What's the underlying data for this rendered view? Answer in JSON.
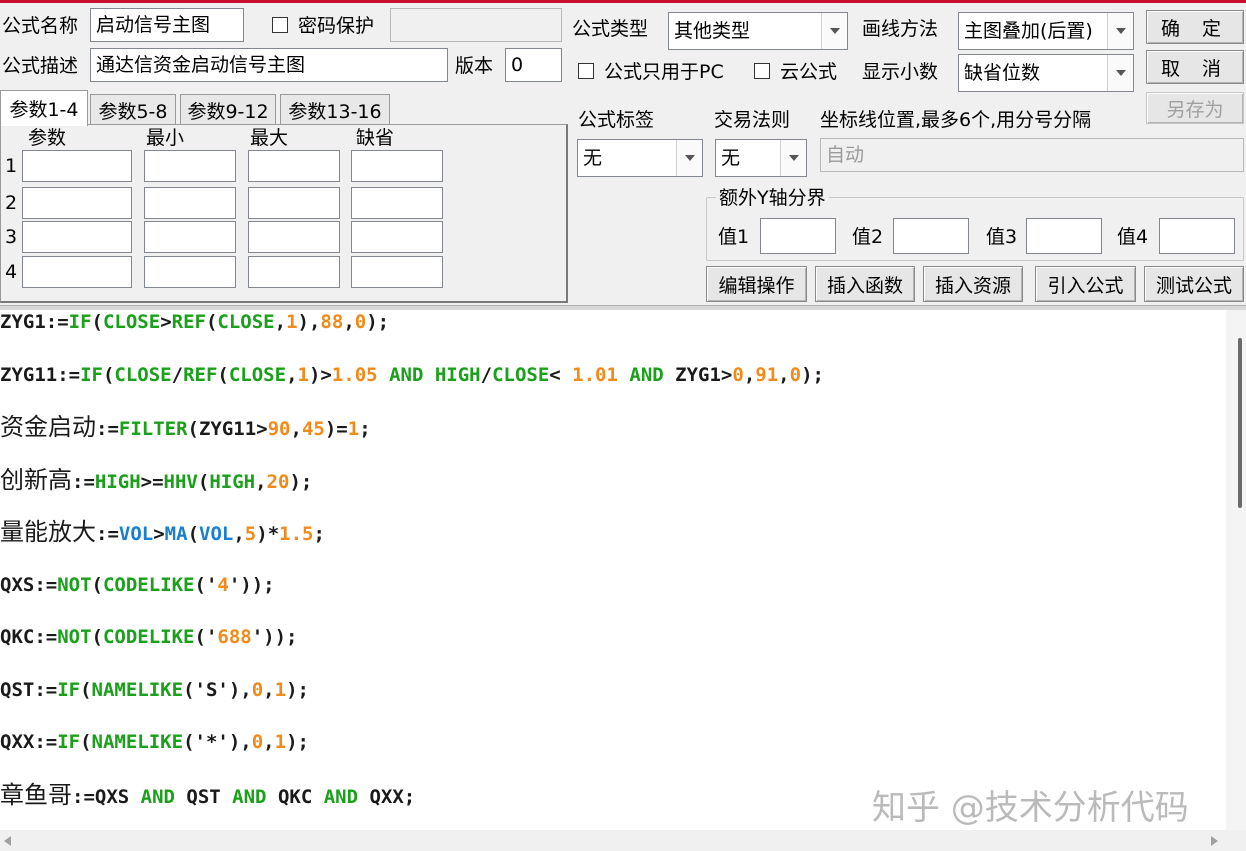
{
  "colors": {
    "title_bar_accent": "#c8102e",
    "code_default": "#1a1a1a",
    "code_function": "#1aa01a",
    "code_number": "#f08a1a",
    "code_volume": "#1a7fd0"
  },
  "form": {
    "name_label": "公式名称",
    "name_value": "启动信号主图",
    "password_label": "密码保护",
    "password_value": "",
    "desc_label": "公式描述",
    "desc_value": "通达信资金启动信号主图",
    "version_label": "版本",
    "version_value": "0",
    "type_label": "公式类型",
    "type_value": "其他类型",
    "draw_label": "画线方法",
    "draw_value": "主图叠加(后置)",
    "pc_only_label": "公式只用于PC",
    "cloud_label": "云公式",
    "decimal_label": "显示小数",
    "decimal_value": "缺省位数",
    "tag_label": "公式标签",
    "tag_value": "无",
    "trade_label": "交易法则",
    "trade_value": "无",
    "axis_label": "坐标线位置,最多6个,用分号分隔",
    "axis_placeholder": "自动",
    "extra_y_label": "额外Y轴分界",
    "extra_y_values": [
      {
        "label": "值1",
        "value": ""
      },
      {
        "label": "值2",
        "value": ""
      },
      {
        "label": "值3",
        "value": ""
      },
      {
        "label": "值4",
        "value": ""
      }
    ]
  },
  "buttons": {
    "ok": "确 定",
    "cancel": "取 消",
    "save_as": "另存为",
    "edit_ops": "编辑操作",
    "insert_func": "插入函数",
    "insert_resource": "插入资源",
    "import_formula": "引入公式",
    "test_formula": "测试公式"
  },
  "tabs": [
    "参数1-4",
    "参数5-8",
    "参数9-12",
    "参数13-16"
  ],
  "params": {
    "headers": [
      "参数",
      "最小",
      "最大",
      "缺省"
    ],
    "rows": [
      {
        "index": "1",
        "name": "",
        "min": "",
        "max": "",
        "default": ""
      },
      {
        "index": "2",
        "name": "",
        "min": "",
        "max": "",
        "default": ""
      },
      {
        "index": "3",
        "name": "",
        "min": "",
        "max": "",
        "default": ""
      },
      {
        "index": "4",
        "name": "",
        "min": "",
        "max": "",
        "default": ""
      }
    ]
  },
  "code": [
    [
      [
        "d",
        "ZYG1:="
      ],
      [
        "f",
        "IF"
      ],
      [
        "d",
        "("
      ],
      [
        "f",
        "CLOSE"
      ],
      [
        "d",
        ">"
      ],
      [
        "f",
        "REF"
      ],
      [
        "d",
        "("
      ],
      [
        "f",
        "CLOSE"
      ],
      [
        "d",
        ","
      ],
      [
        "n",
        "1"
      ],
      [
        "d",
        "),"
      ],
      [
        "n",
        "88"
      ],
      [
        "d",
        ","
      ],
      [
        "n",
        "0"
      ],
      [
        "d",
        ");"
      ]
    ],
    [
      [
        "d",
        "ZYG11:="
      ],
      [
        "f",
        "IF"
      ],
      [
        "d",
        "("
      ],
      [
        "f",
        "CLOSE"
      ],
      [
        "d",
        "/"
      ],
      [
        "f",
        "REF"
      ],
      [
        "d",
        "("
      ],
      [
        "f",
        "CLOSE"
      ],
      [
        "d",
        ","
      ],
      [
        "n",
        "1"
      ],
      [
        "d",
        ")>"
      ],
      [
        "n",
        "1.05"
      ],
      [
        "d",
        " "
      ],
      [
        "f",
        "AND"
      ],
      [
        "d",
        " "
      ],
      [
        "f",
        "HIGH"
      ],
      [
        "d",
        "/"
      ],
      [
        "f",
        "CLOSE"
      ],
      [
        "d",
        "< "
      ],
      [
        "n",
        "1.01"
      ],
      [
        "d",
        " "
      ],
      [
        "f",
        "AND"
      ],
      [
        "d",
        " ZYG1>"
      ],
      [
        "n",
        "0"
      ],
      [
        "d",
        ","
      ],
      [
        "n",
        "91"
      ],
      [
        "d",
        ","
      ],
      [
        "n",
        "0"
      ],
      [
        "d",
        ");"
      ]
    ],
    [
      [
        "c",
        "资金启动"
      ],
      [
        "d",
        ":="
      ],
      [
        "f",
        "FILTER"
      ],
      [
        "d",
        "(ZYG11>"
      ],
      [
        "n",
        "90"
      ],
      [
        "d",
        ","
      ],
      [
        "n",
        "45"
      ],
      [
        "d",
        ")="
      ],
      [
        "n",
        "1"
      ],
      [
        "d",
        ";"
      ]
    ],
    [
      [
        "c",
        "创新高"
      ],
      [
        "d",
        ":="
      ],
      [
        "f",
        "HIGH"
      ],
      [
        "d",
        ">="
      ],
      [
        "f",
        "HHV"
      ],
      [
        "d",
        "("
      ],
      [
        "f",
        "HIGH"
      ],
      [
        "d",
        ","
      ],
      [
        "n",
        "20"
      ],
      [
        "d",
        ");"
      ]
    ],
    [
      [
        "c",
        "量能放大"
      ],
      [
        "d",
        ":="
      ],
      [
        "v",
        "VOL"
      ],
      [
        "d",
        ">"
      ],
      [
        "v",
        "MA"
      ],
      [
        "d",
        "("
      ],
      [
        "v",
        "VOL"
      ],
      [
        "d",
        ","
      ],
      [
        "n",
        "5"
      ],
      [
        "d",
        ")*"
      ],
      [
        "n",
        "1.5"
      ],
      [
        "d",
        ";"
      ]
    ],
    [
      [
        "d",
        "QXS:="
      ],
      [
        "f",
        "NOT"
      ],
      [
        "d",
        "("
      ],
      [
        "f",
        "CODELIKE"
      ],
      [
        "d",
        "('"
      ],
      [
        "n",
        "4"
      ],
      [
        "d",
        "'));"
      ]
    ],
    [
      [
        "d",
        "QKC:="
      ],
      [
        "f",
        "NOT"
      ],
      [
        "d",
        "("
      ],
      [
        "f",
        "CODELIKE"
      ],
      [
        "d",
        "('"
      ],
      [
        "n",
        "688"
      ],
      [
        "d",
        "'));"
      ]
    ],
    [
      [
        "d",
        "QST:="
      ],
      [
        "f",
        "IF"
      ],
      [
        "d",
        "("
      ],
      [
        "f",
        "NAMELIKE"
      ],
      [
        "d",
        "('S'),"
      ],
      [
        "n",
        "0"
      ],
      [
        "d",
        ","
      ],
      [
        "n",
        "1"
      ],
      [
        "d",
        ");"
      ]
    ],
    [
      [
        "d",
        "QXX:="
      ],
      [
        "f",
        "IF"
      ],
      [
        "d",
        "("
      ],
      [
        "f",
        "NAMELIKE"
      ],
      [
        "d",
        "('*'),"
      ],
      [
        "n",
        "0"
      ],
      [
        "d",
        ","
      ],
      [
        "n",
        "1"
      ],
      [
        "d",
        ");"
      ]
    ],
    [
      [
        "c",
        "章鱼哥"
      ],
      [
        "d",
        ":=QXS "
      ],
      [
        "f",
        "AND"
      ],
      [
        "d",
        " QST "
      ],
      [
        "f",
        "AND"
      ],
      [
        "d",
        " QKC "
      ],
      [
        "f",
        "AND"
      ],
      [
        "d",
        " QXX;"
      ]
    ]
  ],
  "watermark": "知乎 @技术分析代码"
}
